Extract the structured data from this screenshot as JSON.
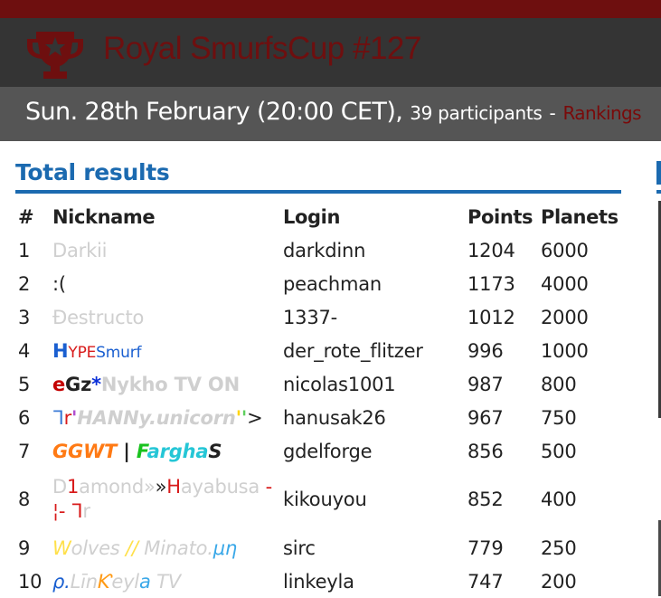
{
  "header": {
    "title": "Royal SmurfsCup #127",
    "date": "Sun. 28th February (20:00 CET),",
    "participants": "39 participants",
    "separator": "-",
    "rankings_link": "Rankings"
  },
  "section": {
    "title": "Total results"
  },
  "table": {
    "columns": [
      "#",
      "Nickname",
      "Login",
      "Points",
      "Planets"
    ],
    "rows": [
      {
        "rank": "1",
        "login": "darkdinn",
        "points": "1204",
        "planets": "6000",
        "nick": [
          {
            "t": " Darkii",
            "c": "#cfcfcf"
          }
        ]
      },
      {
        "rank": "2",
        "login": "peachman",
        "points": "1173",
        "planets": "4000",
        "nick": [
          {
            "t": ":(",
            "c": "#222222"
          }
        ]
      },
      {
        "rank": "3",
        "login": "1337-",
        "points": "1012",
        "planets": "2000",
        "nick": [
          {
            "t": "Đestructo",
            "c": "#cfcfcf"
          }
        ]
      },
      {
        "rank": "4",
        "login": "der_rote_flitzer",
        "points": "996",
        "planets": "1000",
        "nick": [
          {
            "t": "H",
            "c": "#1a5fd0",
            "b": true
          },
          {
            "t": "YPE",
            "c": "#d81b1b",
            "s": 17
          },
          {
            "t": "Smurf",
            "c": "#1a5fd0",
            "s": 17
          }
        ]
      },
      {
        "rank": "5",
        "login": "nicolas1001",
        "points": "987",
        "planets": "800",
        "nick": [
          {
            "t": "e",
            "c": "#c40000",
            "b": true
          },
          {
            "t": "Gz",
            "c": "#222222",
            "b": true
          },
          {
            "t": "*",
            "c": "#0a2fd8",
            "b": true
          },
          {
            "t": "Nykho TV ON",
            "c": "#cfcfcf",
            "b": true
          }
        ]
      },
      {
        "rank": "6",
        "login": "hanusak26",
        "points": "967",
        "planets": "750",
        "nick": [
          {
            "t": "ᒣ",
            "c": "#3a7ad6"
          },
          {
            "t": "r",
            "c": "#d81b1b"
          },
          {
            "t": "'",
            "c": "#b04fd0",
            "b": true,
            "i": true
          },
          {
            "t": "HANNy.unicorn",
            "c": "#cfcfcf",
            "b": true,
            "i": true
          },
          {
            "t": "'",
            "c": "#ffd400",
            "b": true
          },
          {
            "t": "'",
            "c": "#5fd05f",
            "b": true
          },
          {
            "t": ">",
            "c": "#222222"
          }
        ]
      },
      {
        "rank": "7",
        "login": "gdelforge",
        "points": "856",
        "planets": "500",
        "nick": [
          {
            "t": "GGWT",
            "c": "#ff7a14",
            "b": true,
            "i": true
          },
          {
            "t": " | ",
            "c": "#222222",
            "b": true
          },
          {
            "t": "F",
            "c": "#19c21e",
            "b": true,
            "i": true
          },
          {
            "t": "argha",
            "c": "#25c6d6",
            "b": true,
            "i": true
          },
          {
            "t": "S",
            "c": "#222222",
            "b": true,
            "i": true
          }
        ]
      },
      {
        "rank": "8",
        "login": "kikouyou",
        "points": "852",
        "planets": "400",
        "tall": true,
        "nick": [
          {
            "t": "D",
            "c": "#cfcfcf"
          },
          {
            "t": "1",
            "c": "#d81b1b"
          },
          {
            "t": "amond»",
            "c": "#cfcfcf"
          },
          {
            "t": "»",
            "c": "#222222"
          },
          {
            "t": "H",
            "c": "#d81b1b"
          },
          {
            "t": "ayabusa ",
            "c": "#cfcfcf"
          },
          {
            "t": "- ",
            "c": "#d81b1b"
          },
          {
            "t": "¦- ",
            "c": "#d81b1b"
          },
          {
            "t": "ᒣ",
            "c": "#d81b1b"
          },
          {
            "t": "r",
            "c": "#cfcfcf"
          }
        ]
      },
      {
        "rank": "9",
        "login": "sirc",
        "points": "779",
        "planets": "250",
        "nick": [
          {
            "t": "W",
            "c": "#ffe04a",
            "i": true
          },
          {
            "t": "olves ",
            "c": "#cfcfcf",
            "i": true
          },
          {
            "t": "//",
            "c": "#ffe04a",
            "i": true
          },
          {
            "t": " Minato.",
            "c": "#cfcfcf",
            "i": true
          },
          {
            "t": "μη",
            "c": "#3aa8e8",
            "i": true
          }
        ]
      },
      {
        "rank": "10",
        "login": "linkeyla",
        "points": "747",
        "planets": "200",
        "nick": [
          {
            "t": "ρ.",
            "c": "#1a5fd0",
            "i": true
          },
          {
            "t": "Lī",
            "c": "#cfcfcf",
            "i": true
          },
          {
            "t": "n",
            "c": "#cfcfcf",
            "i": true
          },
          {
            "t": "Ƙ",
            "c": "#ff9a14",
            "i": true
          },
          {
            "t": "eyl",
            "c": "#cfcfcf",
            "i": true
          },
          {
            "t": "a",
            "c": "#3aa8e8",
            "i": true
          },
          {
            "t": " TV",
            "c": "#cfcfcf",
            "i": true
          }
        ]
      }
    ]
  },
  "colors": {
    "topbar": "#6e0f0f",
    "titlebar": "#343434",
    "subbar": "#555555",
    "accent": "#1b6ab0",
    "title_text": "#6e0f0f"
  },
  "icons": {
    "logo": "trophy-star-icon"
  }
}
